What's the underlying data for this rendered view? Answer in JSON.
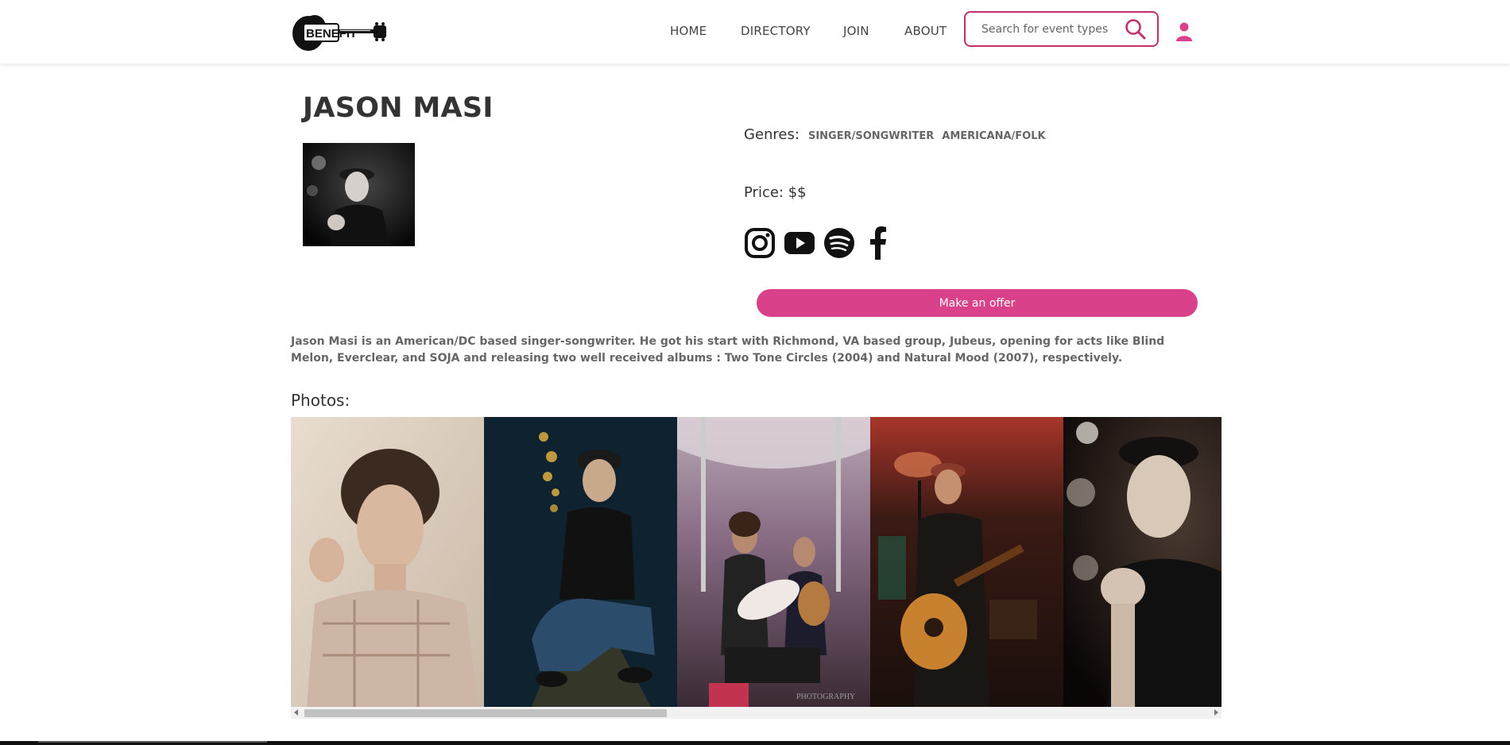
{
  "header": {
    "logo_text": "BENEFIT",
    "nav": [
      {
        "label": "HOME"
      },
      {
        "label": "DIRECTORY"
      },
      {
        "label": "JOIN"
      },
      {
        "label": "ABOUT"
      }
    ],
    "search": {
      "placeholder": "Search for event types",
      "value": ""
    },
    "icons": {
      "search": "search-icon",
      "user": "user-icon"
    }
  },
  "profile": {
    "name": "JASON MASI",
    "genres_label": "Genres:",
    "genres": [
      "SINGER/SONGWRITER",
      "AMERICANA/FOLK"
    ],
    "price": "Price: $$",
    "socials": [
      "instagram-icon",
      "youtube-icon",
      "spotify-icon",
      "facebook-icon"
    ],
    "offer_button": "Make an offer",
    "bio": "Jason Masi is an American/DC based singer-songwriter. He got his start with Richmond, VA based group, Jubeus, opening for acts like Blind Melon, Everclear, and SOJA and releasing two well received albums : Two Tone Circles (2004) and Natural Mood (2007), respectively."
  },
  "photos": {
    "label": "Photos:",
    "count_visible": 5
  },
  "colors": {
    "accent": "#d9428a",
    "search_border": "#c0306d",
    "text_dark": "#333333",
    "text_muted": "#666666"
  }
}
